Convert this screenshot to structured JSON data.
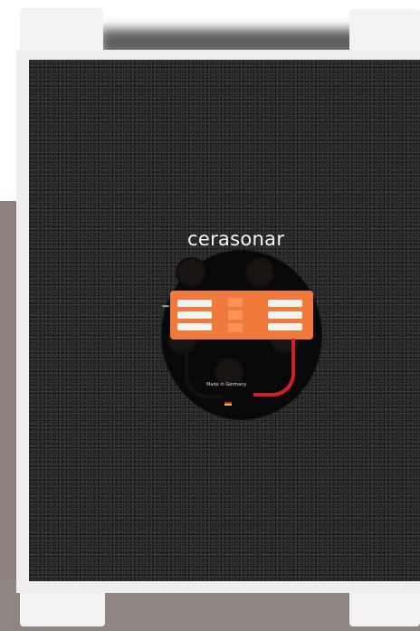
{
  "brand": {
    "name": "cerasonar"
  },
  "labels": {
    "minus": "−",
    "plus": "+",
    "made_in": "Made in Germany"
  },
  "colors": {
    "foam": "#222222",
    "frame": "#eeeeee",
    "connector": "#f07a3c",
    "wire_red": "#d11f23",
    "wire_black": "#111111"
  }
}
